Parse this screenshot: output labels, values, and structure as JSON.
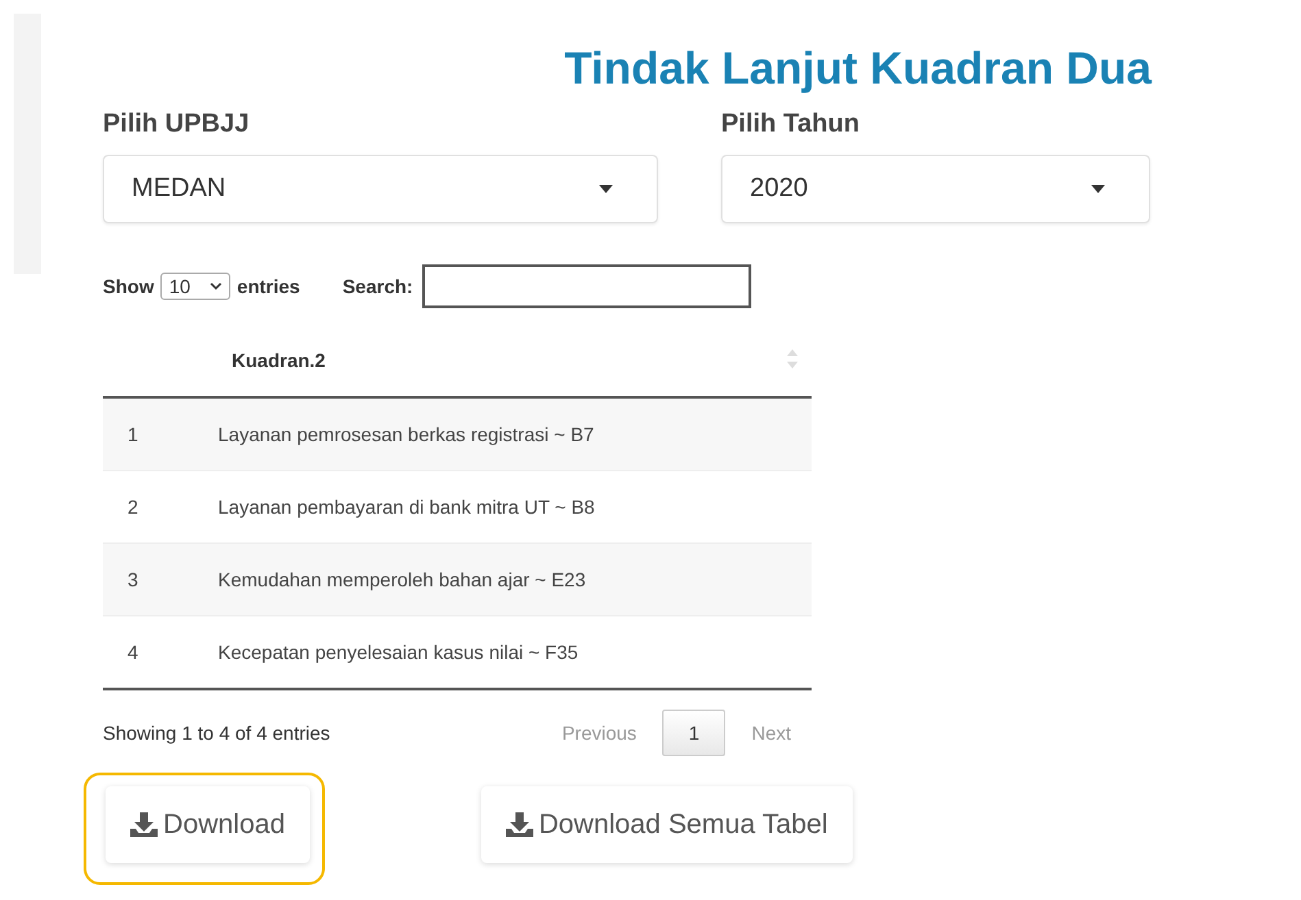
{
  "title": "Tindak Lanjut Kuadran Dua",
  "filters": [
    {
      "label": "Pilih UPBJJ",
      "value": "MEDAN"
    },
    {
      "label": "Pilih Tahun",
      "value": "2020"
    }
  ],
  "table_controls": {
    "show_label": "Show",
    "page_size": "10",
    "entries_label": "entries",
    "search_label": "Search:"
  },
  "table": {
    "columns": [
      "",
      "Kuadran.2"
    ],
    "rows": [
      [
        "1",
        "Layanan pemrosesan berkas registrasi ~ B7"
      ],
      [
        "2",
        "Layanan pembayaran di bank mitra UT ~ B8"
      ],
      [
        "3",
        "Kemudahan memperoleh bahan ajar ~ E23"
      ],
      [
        "4",
        "Kecepatan penyelesaian kasus nilai ~ F35"
      ]
    ]
  },
  "info": "Showing 1 to 4 of 4 entries",
  "pagination": [
    {
      "label": "Previous",
      "kind": "nav",
      "selected": false
    },
    {
      "label": "1",
      "kind": "page",
      "selected": true
    },
    {
      "label": "Next",
      "kind": "nav",
      "selected": false
    }
  ],
  "buttons": [
    {
      "label": "Download",
      "highlighted": true
    },
    {
      "label": "Download Semua Tabel",
      "highlighted": false
    }
  ]
}
